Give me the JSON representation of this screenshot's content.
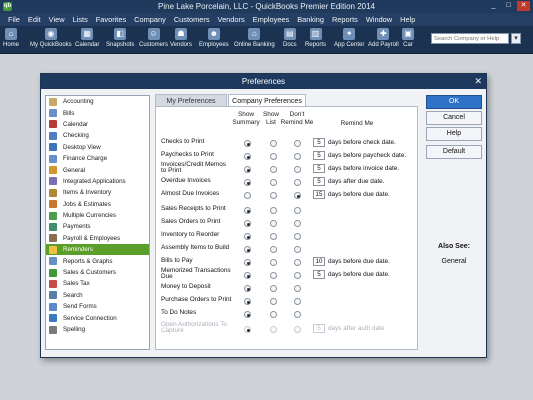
{
  "app": {
    "title": "Pine Lake Porcelain, LLC  -  QuickBooks Premier Edition 2014",
    "icon_letter": "qb",
    "controls": [
      "_",
      "□",
      "✕"
    ]
  },
  "menu": [
    "File",
    "Edit",
    "View",
    "Lists",
    "Favorites",
    "Company",
    "Customers",
    "Vendors",
    "Employees",
    "Banking",
    "Reports",
    "Window",
    "Help"
  ],
  "toolbar": {
    "items": [
      {
        "label": "Home",
        "icon": "home-icon",
        "glyph": "⌂"
      },
      {
        "label": "My QuickBooks",
        "icon": "my-quickbooks-icon",
        "glyph": "◉"
      },
      {
        "label": "Calendar",
        "icon": "calendar-icon",
        "glyph": "▦"
      },
      {
        "label": "Snapshots",
        "icon": "snapshots-icon",
        "glyph": "◧"
      },
      {
        "label": "Customers",
        "icon": "customers-icon",
        "glyph": "☺"
      },
      {
        "label": "Vendors",
        "icon": "vendors-icon",
        "glyph": "☗"
      },
      {
        "label": "Employees",
        "icon": "employees-icon",
        "glyph": "☻"
      },
      {
        "label": "Online Banking",
        "icon": "online-banking-icon",
        "glyph": "⌂"
      },
      {
        "label": "Docs",
        "icon": "docs-icon",
        "glyph": "▤"
      },
      {
        "label": "Reports",
        "icon": "reports-icon",
        "glyph": "▥"
      },
      {
        "label": "App Center",
        "icon": "app-center-icon",
        "glyph": "✦"
      },
      {
        "label": "Add Payroll",
        "icon": "add-payroll-icon",
        "glyph": "✚"
      },
      {
        "label": "Car",
        "icon": "car-icon",
        "glyph": "▣"
      }
    ],
    "search_placeholder": "Search Company or Help",
    "search_button": "▾"
  },
  "dialog": {
    "title": "Preferences",
    "close": "✕",
    "categories": [
      {
        "label": "Accounting",
        "color": "#c9a86b"
      },
      {
        "label": "Bills",
        "color": "#6a8fc7"
      },
      {
        "label": "Calendar",
        "color": "#b33b3b"
      },
      {
        "label": "Checking",
        "color": "#4f7fbf"
      },
      {
        "label": "Desktop View",
        "color": "#3d74b8"
      },
      {
        "label": "Finance Charge",
        "color": "#6a8fc7"
      },
      {
        "label": "General",
        "color": "#d1962c"
      },
      {
        "label": "Integrated Applications",
        "color": "#7a6fb5"
      },
      {
        "label": "Items & Inventory",
        "color": "#b0883a"
      },
      {
        "label": "Jobs & Estimates",
        "color": "#c8762e"
      },
      {
        "label": "Multiple Currencies",
        "color": "#4e9a4e"
      },
      {
        "label": "Payments",
        "color": "#3f8f6f"
      },
      {
        "label": "Payroll & Employees",
        "color": "#8a6f55"
      },
      {
        "label": "Reminders",
        "color": "#f0c040"
      },
      {
        "label": "Reports & Graphs",
        "color": "#6a8fc7"
      },
      {
        "label": "Sales & Customers",
        "color": "#3c9a3a"
      },
      {
        "label": "Sales Tax",
        "color": "#c84b4b"
      },
      {
        "label": "Search",
        "color": "#5a7ea8"
      },
      {
        "label": "Send Forms",
        "color": "#5a8ac9"
      },
      {
        "label": "Service Connection",
        "color": "#3a7abf"
      },
      {
        "label": "Spelling",
        "color": "#7a7a7a"
      }
    ],
    "selected_category": "Reminders",
    "tabs": {
      "my": "My Preferences",
      "company": "Company Preferences"
    },
    "columns": {
      "show_summary": [
        "Show",
        "Summary"
      ],
      "show_list": [
        "Show",
        "List"
      ],
      "dont_remind": [
        "Don't",
        "Remind Me"
      ],
      "remind_me": "Remind Me"
    },
    "rows": [
      {
        "label": "Checks to Print",
        "sel": "summary",
        "days": "5",
        "text": "days before check date.",
        "disabled": false
      },
      {
        "label": "Paychecks to Print",
        "sel": "summary",
        "days": "5",
        "text": "days before paycheck date.",
        "disabled": false
      },
      {
        "label": "Invoices/Credit Memos to Print",
        "sel": "summary",
        "days": "5",
        "text": "days before invoice date.",
        "disabled": false
      },
      {
        "label": "Overdue Invoices",
        "sel": "summary",
        "days": "5",
        "text": "days after due date.",
        "disabled": false
      },
      {
        "label": "Almost Due Invoices",
        "sel": "dont",
        "days": "15",
        "text": "days before due date.",
        "disabled": false
      },
      {
        "label": "Sales Receipts to Print",
        "sel": "summary",
        "days": "",
        "text": "",
        "disabled": false
      },
      {
        "label": "Sales Orders to Print",
        "sel": "summary",
        "days": "",
        "text": "",
        "disabled": false
      },
      {
        "label": "Inventory to Reorder",
        "sel": "summary",
        "days": "",
        "text": "",
        "disabled": false
      },
      {
        "label": "Assembly Items to Build",
        "sel": "summary",
        "days": "",
        "text": "",
        "disabled": false
      },
      {
        "label": "Bills to Pay",
        "sel": "summary",
        "days": "10",
        "text": "days before due date.",
        "disabled": false
      },
      {
        "label": "Memorized Transactions Due",
        "sel": "summary",
        "days": "5",
        "text": "days before due date.",
        "disabled": false
      },
      {
        "label": "Money to Deposit",
        "sel": "summary",
        "days": "",
        "text": "",
        "disabled": false
      },
      {
        "label": "Purchase Orders to Print",
        "sel": "summary",
        "days": "",
        "text": "",
        "disabled": false
      },
      {
        "label": "To Do Notes",
        "sel": "summary",
        "days": "",
        "text": "",
        "disabled": false
      },
      {
        "label": "Open Authorizations To Capture",
        "sel": "summary",
        "days": "5",
        "text": "days after auth date",
        "disabled": true
      }
    ],
    "buttons": {
      "ok": "OK",
      "cancel": "Cancel",
      "help": "Help",
      "default": "Default"
    },
    "also_see": {
      "label": "Also See:",
      "link": "General"
    }
  }
}
